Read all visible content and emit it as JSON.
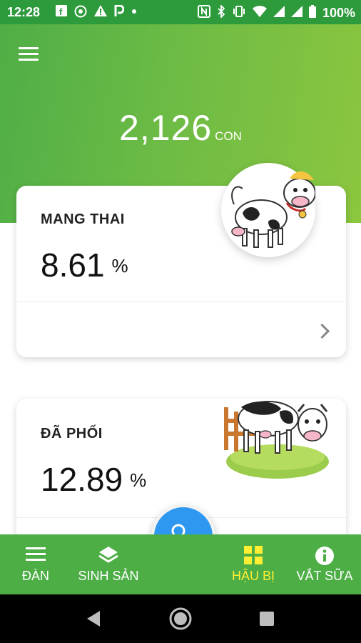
{
  "status_bar": {
    "time": "12:28",
    "left_icons": [
      "facebook-icon",
      "settings-badge-icon",
      "warning-icon",
      "p-icon",
      "dot-icon"
    ],
    "right_icons": [
      "nfc-icon",
      "bluetooth-icon",
      "vibrate-icon",
      "wifi-icon",
      "signal-icon",
      "signal-icon",
      "battery-icon"
    ],
    "battery": "100%"
  },
  "header": {
    "total_count": "2,126",
    "total_unit": "CON"
  },
  "cards": [
    {
      "title": "MANG THAI",
      "value": "8.61",
      "unit": "%"
    },
    {
      "title": "ĐÃ PHỐI",
      "value": "12.89",
      "unit": "%"
    }
  ],
  "bottom_nav": {
    "items": [
      {
        "label": "ĐÀN",
        "icon": "menu-icon"
      },
      {
        "label": "SINH SẢN",
        "icon": "layers-icon"
      },
      {
        "label": "HẬU BỊ",
        "icon": "grid-icon",
        "active": true
      },
      {
        "label": "VẮT SỮA",
        "icon": "info-icon"
      }
    ],
    "fab_icon": "search-icon"
  },
  "colors": {
    "header_green": "#6cbb45",
    "nav_green": "#4dae46",
    "status_green": "#2d9a3c",
    "fab_blue": "#2e98f0",
    "active_yellow": "#ffee33"
  }
}
